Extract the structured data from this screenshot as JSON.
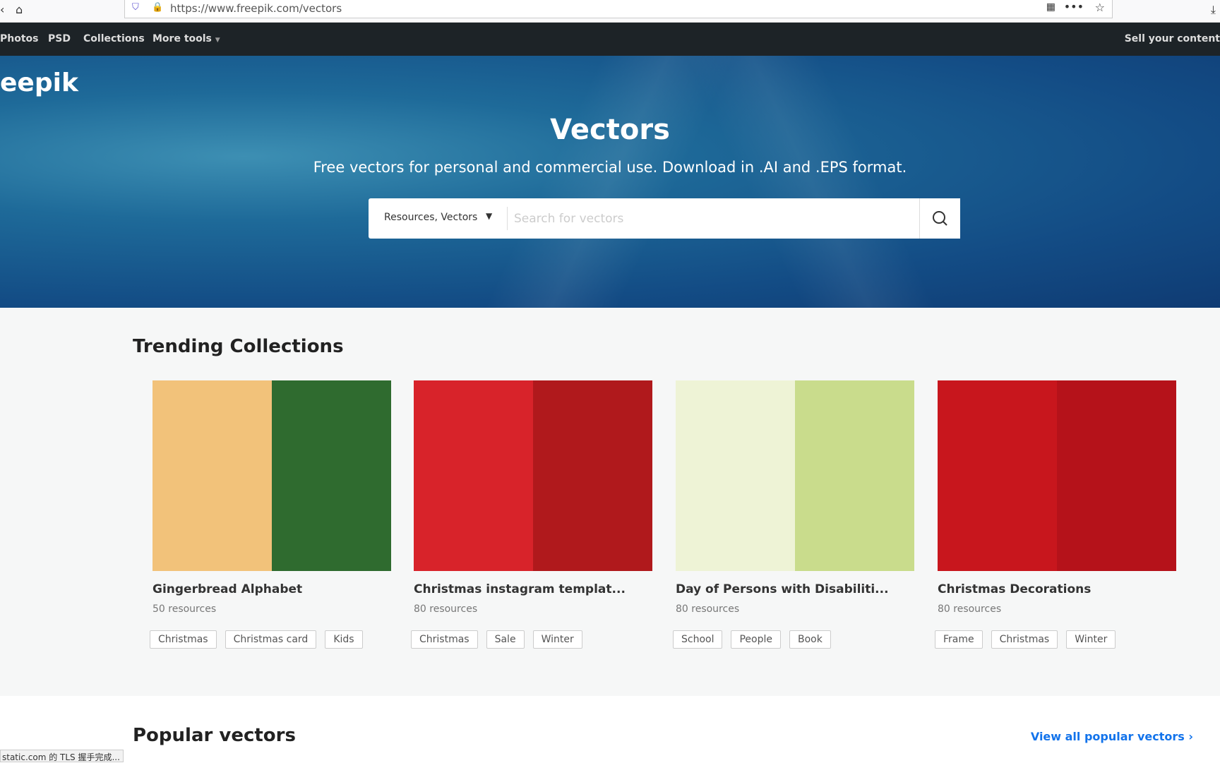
{
  "browser": {
    "url": "https://www.freepik.com/vectors",
    "status": "static.com 的 TLS 握手完成..."
  },
  "nav": {
    "items": [
      "Photos",
      "PSD",
      "Collections",
      "More tools"
    ],
    "right": "Sell your content"
  },
  "hero": {
    "logo": "eepik",
    "title": "Vectors",
    "subtitle": "Free vectors for personal and commercial use. Download in .AI and .EPS format.",
    "search_type": "Resources, Vectors",
    "search_placeholder": "Search for vectors"
  },
  "trending": {
    "heading": "Trending Collections",
    "cards": [
      {
        "title": "Gingerbread Alphabet",
        "resources": "50 resources",
        "tags": [
          "Christmas",
          "Christmas card",
          "Kids"
        ],
        "colors": [
          "#f2c27a",
          "#2f6b2f"
        ]
      },
      {
        "title": "Christmas instagram templat...",
        "resources": "80 resources",
        "tags": [
          "Christmas",
          "Sale",
          "Winter"
        ],
        "colors": [
          "#d8232a",
          "#b0191c"
        ]
      },
      {
        "title": "Day of Persons with Disabiliti...",
        "resources": "80 resources",
        "tags": [
          "School",
          "People",
          "Book"
        ],
        "colors": [
          "#eef3d6",
          "#c9dc8c"
        ]
      },
      {
        "title": "Christmas Decorations",
        "resources": "80 resources",
        "tags": [
          "Frame",
          "Christmas",
          "Winter"
        ],
        "colors": [
          "#c8161d",
          "#b5121a"
        ]
      }
    ]
  },
  "popular": {
    "heading": "Popular vectors",
    "view_all": "View all popular vectors"
  }
}
